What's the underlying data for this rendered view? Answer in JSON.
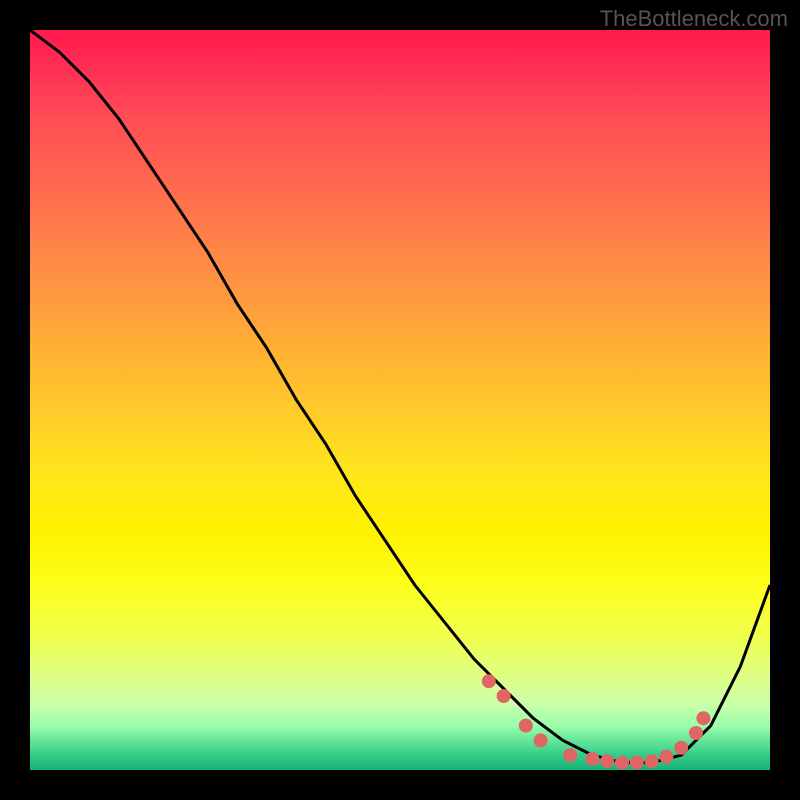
{
  "watermark": "TheBottleneck.com",
  "chart_data": {
    "type": "line",
    "title": "",
    "xlabel": "",
    "ylabel": "",
    "xlim": [
      0,
      100
    ],
    "ylim": [
      0,
      100
    ],
    "series": [
      {
        "name": "curve",
        "x": [
          0,
          4,
          8,
          12,
          16,
          20,
          24,
          28,
          32,
          36,
          40,
          44,
          48,
          52,
          56,
          60,
          64,
          68,
          72,
          76,
          80,
          84,
          88,
          92,
          96,
          100
        ],
        "y": [
          100,
          97,
          93,
          88,
          82,
          76,
          70,
          63,
          57,
          50,
          44,
          37,
          31,
          25,
          20,
          15,
          11,
          7,
          4,
          2,
          1,
          1,
          2,
          6,
          14,
          25
        ]
      }
    ],
    "markers": [
      {
        "x": 62,
        "y": 12
      },
      {
        "x": 64,
        "y": 10
      },
      {
        "x": 67,
        "y": 6
      },
      {
        "x": 69,
        "y": 4
      },
      {
        "x": 73,
        "y": 2
      },
      {
        "x": 76,
        "y": 1.5
      },
      {
        "x": 78,
        "y": 1.2
      },
      {
        "x": 80,
        "y": 1
      },
      {
        "x": 82,
        "y": 1
      },
      {
        "x": 84,
        "y": 1.2
      },
      {
        "x": 86,
        "y": 1.8
      },
      {
        "x": 88,
        "y": 3
      },
      {
        "x": 90,
        "y": 5
      },
      {
        "x": 91,
        "y": 7
      }
    ],
    "gradient_stops": [
      {
        "pos": 0,
        "color": "#ff1a4d"
      },
      {
        "pos": 50,
        "color": "#ffcc2a"
      },
      {
        "pos": 75,
        "color": "#fcff1a"
      },
      {
        "pos": 100,
        "color": "#1ab377"
      }
    ]
  }
}
